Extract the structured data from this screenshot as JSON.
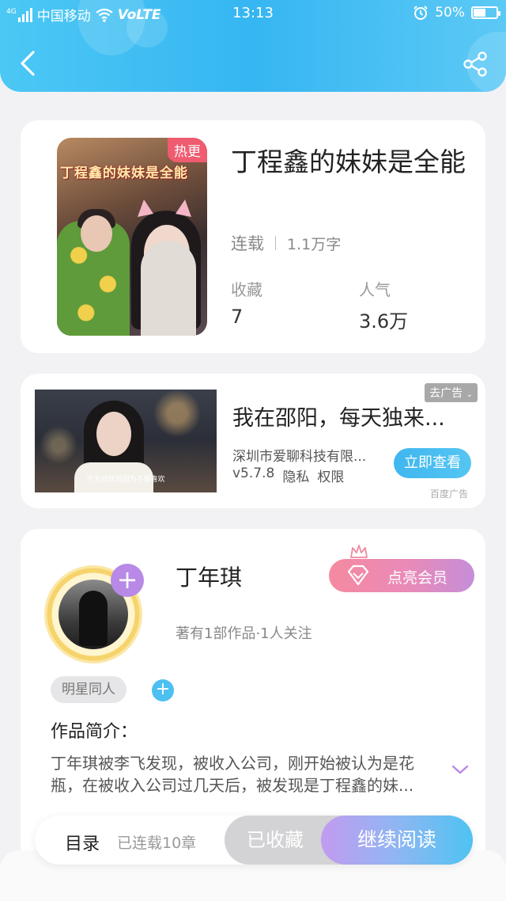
{
  "status_bar": {
    "network": "4G",
    "carrier": "中国移动",
    "volte": "VoLTE",
    "time": "13:13",
    "battery": "50%",
    "battery_level": 0.5
  },
  "book": {
    "badge": "热更",
    "cover_title": "丁程鑫的妹妹是全能",
    "title": "丁程鑫的妹妹是全能",
    "status": "连载",
    "word_count": "1.1万字",
    "favorites_label": "收藏",
    "favorites_value": "7",
    "popularity_label": "人气",
    "popularity_value": "3.6万"
  },
  "ad": {
    "remove_label": "去广告",
    "title": "我在邵阳，每天独来...",
    "company": "深圳市爱聊科技有限...",
    "version": "v5.7.8",
    "privacy": "隐私",
    "permissions": "权限",
    "cta": "立即查看",
    "source": "百度广告",
    "image_caption": "不主动就是因为不够喜欢"
  },
  "author": {
    "name": "丁年琪",
    "stats": "著有1部作品·1人关注",
    "vip_label": "点亮会员",
    "tag": "明星同人",
    "intro_label": "作品简介：",
    "intro_text": "丁年琪被李飞发现，被收入公司，刚开始被认为是花瓶，在被收入公司过几天后，被发现是丁程鑫的妹..."
  },
  "bottom_bar": {
    "toc_label": "目录",
    "chapters": "已连载10章",
    "collected_label": "已收藏",
    "read_label": "继续阅读"
  },
  "colors": {
    "header": "#36b6f2",
    "accent_purple": "#b889e6",
    "vip_pink": "#f58aa0",
    "hot_badge": "#ef5b6f"
  },
  "icons": [
    "back-icon",
    "share-icon",
    "signal-icon",
    "wifi-icon",
    "alarm-icon",
    "battery-icon",
    "diamond-icon",
    "crown-icon",
    "plus-icon",
    "chevron-down-icon"
  ]
}
